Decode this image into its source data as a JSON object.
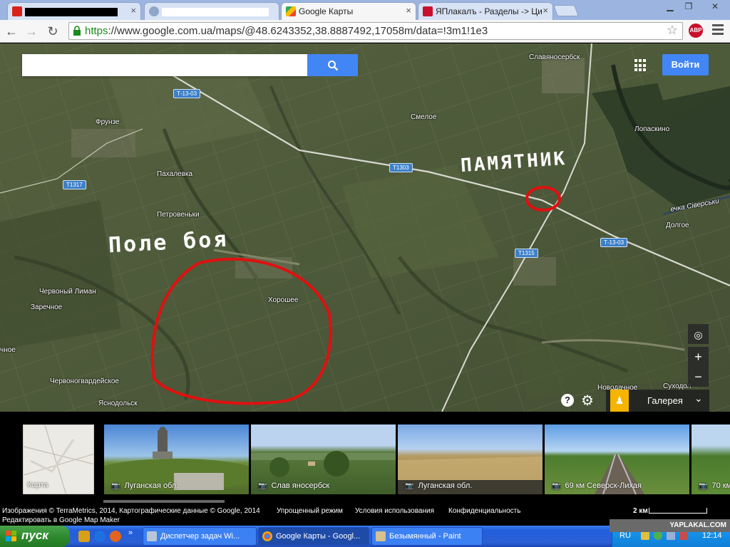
{
  "browser": {
    "tabs": [
      {
        "label": "",
        "redacted": "black"
      },
      {
        "label": "",
        "redacted": "white"
      },
      {
        "label": "Google Карты",
        "active": true
      },
      {
        "label": "ЯПлакалъ - Разделы -> Ци"
      }
    ],
    "url_scheme": "https",
    "url_rest": "://www.google.com.ua/maps/@48.6243352,38.8887492,17058m/data=!3m1!1e3",
    "abp_label": "ABP"
  },
  "map": {
    "search": {
      "placeholder": "",
      "value": ""
    },
    "signin_label": "Войти",
    "gallery_label": "Галерея",
    "zoom_in": "+",
    "zoom_out": "−",
    "help_label": "?",
    "places": {
      "slavyanoserbsk": "Славяносербск",
      "frunze": "Фрунзе",
      "smeloe": "Смелое",
      "lopaskino": "Лопаскино",
      "pakhalevka": "Пахалевка",
      "petrovenki": "Петровеньки",
      "dolgoe": "Долгое",
      "khoroshee": "Хорошее",
      "chervony_liman": "Червоный Лиман",
      "zarechnoe": "Заречное",
      "chnoe": "чное",
      "chervonogvardeyskoe": "Червоногвардейское",
      "yasnodolsk": "Яснодольск",
      "novodachnoe": "Новодачное",
      "sukhodol": "Суходол",
      "river": "ечка Сіверськи"
    },
    "roads": {
      "t1303_top": "Т-13-03",
      "t1303_mid": "Т1303",
      "t1303_right": "Т-13-03",
      "t1317": "Т1317",
      "t1315": "Т1315"
    },
    "annotations": {
      "monument": "ПАМЯТНИК",
      "battlefield": "Поле боя"
    }
  },
  "photo_strip": {
    "map_thumb_label": "Карта",
    "photos": [
      {
        "caption": "Луганская обл."
      },
      {
        "caption": "Слав яносербск"
      },
      {
        "caption": "Луганская обл."
      },
      {
        "caption": "69 км Северск-Лихая"
      },
      {
        "caption": "70 км"
      }
    ]
  },
  "footer": {
    "copyright": "Изображения © TerraMetrics, 2014, Картографические данные © Google, 2014",
    "simple_mode": "Упрощенный режим",
    "terms": "Условия использования",
    "privacy": "Конфиденциальность",
    "mapmaker": "Редактировать в Google Map Maker",
    "scale": "2 км"
  },
  "taskbar": {
    "start_label": "пуск",
    "buttons": [
      {
        "label": "Диспетчер задач Wi..."
      },
      {
        "label": "Google Карты - Googl..."
      },
      {
        "label": "Безымянный - Paint"
      }
    ],
    "lang": "RU",
    "clock": "12:14"
  },
  "watermark": "YAPLAKAL.COM",
  "colors": {
    "accent": "#4285f4",
    "annotation_red": "#e01010",
    "road_badge": "#3d80c8"
  }
}
